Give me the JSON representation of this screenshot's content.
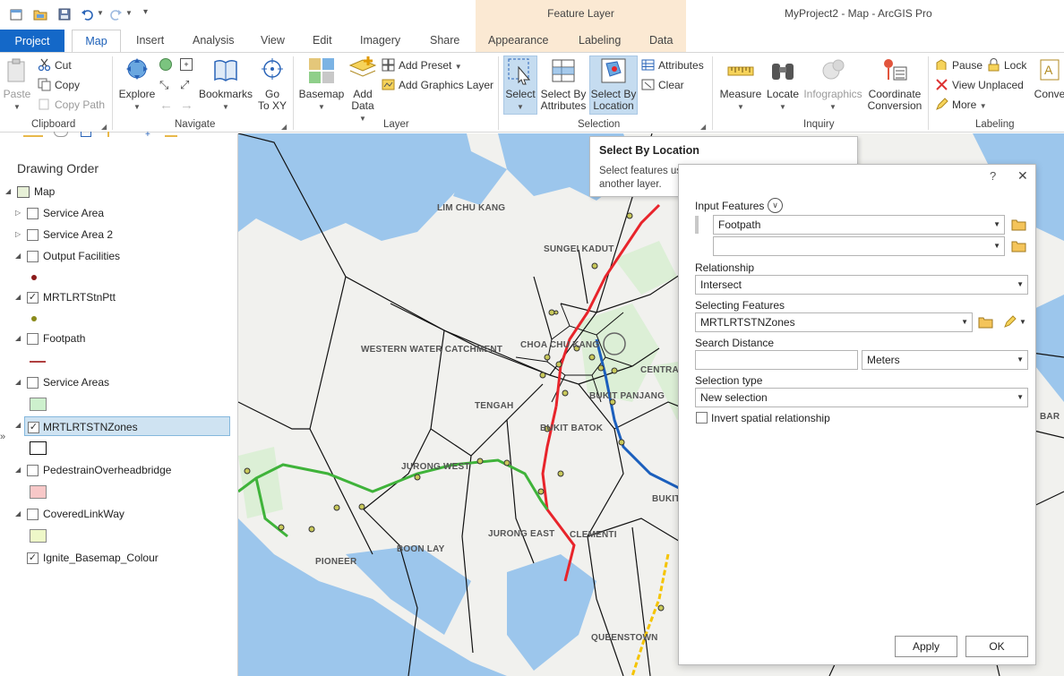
{
  "titlebar": {
    "context_header": "Feature Layer",
    "app_title": "MyProject2 - Map - ArcGIS Pro",
    "icons": [
      "new-project-icon",
      "open-project-icon",
      "save-project-icon",
      "undo-icon",
      "redo-icon",
      "customize-icon"
    ]
  },
  "tabs": {
    "project": "Project",
    "items": [
      "Map",
      "Insert",
      "Analysis",
      "View",
      "Edit",
      "Imagery",
      "Share",
      "Appearance",
      "Labeling",
      "Data"
    ]
  },
  "ribbon": {
    "clipboard": {
      "label": "Clipboard",
      "paste": "Paste",
      "cut": "Cut",
      "copy": "Copy",
      "copy_path": "Copy Path"
    },
    "navigate": {
      "label": "Navigate",
      "explore": "Explore",
      "bookmarks": "Bookmarks",
      "go_to_xy_1": "Go",
      "go_to_xy_2": "To XY"
    },
    "layer": {
      "label": "Layer",
      "basemap": "Basemap",
      "add_data_1": "Add",
      "add_data_2": "Data",
      "add_preset": "Add Preset",
      "add_graphics_layer": "Add Graphics Layer"
    },
    "selection": {
      "label": "Selection",
      "select": "Select",
      "select_by_attr_1": "Select By",
      "select_by_attr_2": "Attributes",
      "select_by_loc_1": "Select By",
      "select_by_loc_2": "Location",
      "attributes": "Attributes",
      "clear": "Clear"
    },
    "inquiry": {
      "label": "Inquiry",
      "measure": "Measure",
      "locate": "Locate",
      "infographics": "Infographics",
      "coord_1": "Coordinate",
      "coord_2": "Conversion"
    },
    "labeling": {
      "label": "Labeling",
      "pause": "Pause",
      "lock": "Lock",
      "view_unplaced": "View Unplaced",
      "more": "More",
      "convert": "Conve"
    }
  },
  "contents": {
    "title": "Drawing Order",
    "layers": [
      {
        "name": "Map",
        "checked": false,
        "expand": "▲"
      },
      {
        "name": "Service Area",
        "checked": false,
        "expand": "▷"
      },
      {
        "name": "Service Area 2",
        "checked": false,
        "expand": "▷"
      },
      {
        "name": "Output Facilities",
        "checked": false,
        "expand": "◢"
      },
      {
        "name": "MRTLRTStnPtt",
        "checked": true,
        "expand": "◢"
      },
      {
        "name": "Footpath",
        "checked": false,
        "expand": "◢"
      },
      {
        "name": "Service Areas",
        "checked": false,
        "expand": "◢"
      },
      {
        "name": "MRTLRTSTNZones",
        "checked": true,
        "expand": "◢"
      },
      {
        "name": "PedestrainOverheadbridge",
        "checked": false,
        "expand": "◢"
      },
      {
        "name": "CoveredLinkWay",
        "checked": false,
        "expand": "◢"
      },
      {
        "name": "Ignite_Basemap_Colour",
        "checked": true,
        "expand": ""
      }
    ],
    "check_mark": "✓"
  },
  "map": {
    "places": [
      "LIM CHU KANG",
      "SUNGEI KADUT",
      "WESTERN WATER CATCHMENT",
      "CHOA CHU KANG",
      "CENTRAL",
      "BUKIT PANJANG",
      "TENGAH",
      "BUKIT BATOK",
      "JURONG WEST",
      "JURONG EAST",
      "CLEMENTI",
      "BOON LAY",
      "PIONEER",
      "QUEENSTOWN",
      "BUKIT",
      "BAR"
    ],
    "colors": {
      "water": "#9cc6ec",
      "land": "#f1f1ee",
      "green": "#dcefd6",
      "red_line": "#e8242b",
      "green_line": "#3fb33a",
      "blue_line": "#1b5fbd",
      "yellow_line": "#f5c400"
    }
  },
  "tooltip": {
    "title": "Select By Location",
    "description": "Select features using the location of features in another layer."
  },
  "dialog": {
    "help": "?",
    "close": "✕",
    "input_features_label": "Input Features",
    "input_features_value": "Footpath",
    "input_features_value2": "",
    "relationship_label": "Relationship",
    "relationship_value": "Intersect",
    "selecting_features_label": "Selecting Features",
    "selecting_features_value": "MRTLRTSTNZones",
    "search_distance_label": "Search Distance",
    "search_distance_value": "",
    "search_distance_unit": "Meters",
    "selection_type_label": "Selection type",
    "selection_type_value": "New selection",
    "invert_label": "Invert spatial relationship",
    "apply": "Apply",
    "ok": "OK"
  }
}
